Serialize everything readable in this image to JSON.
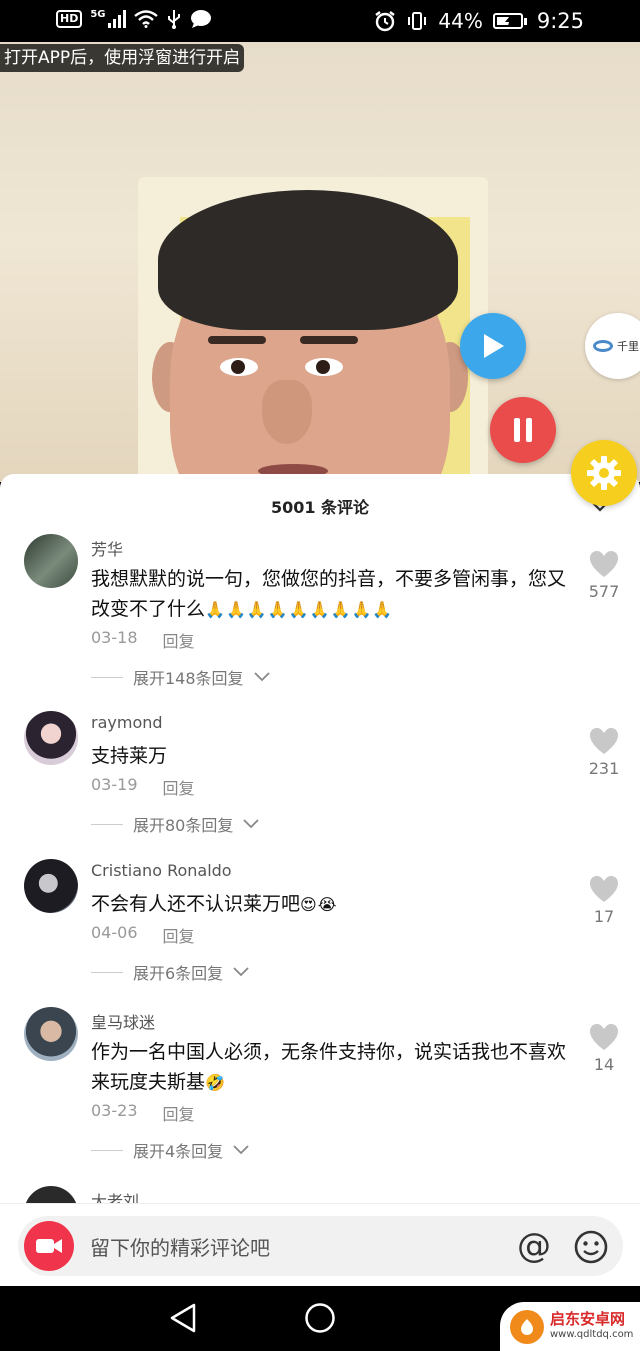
{
  "status_bar": {
    "hd": "HD",
    "network": "5G",
    "battery_percent": "44%",
    "battery_level": 0.44,
    "time": "9:25",
    "icons": [
      "signal-icon",
      "wifi-icon",
      "usb-icon",
      "chat-icon",
      "alarm-icon",
      "vibrate-icon",
      "battery-icon"
    ]
  },
  "video": {
    "banner": "打开APP后，使用浮窗进行开启",
    "side_logo_text": "千里"
  },
  "comments_panel": {
    "title": "5001 条评论",
    "reply_label": "回复",
    "comments": [
      {
        "user": "芳华",
        "text": "我想默默的说一句，您做您的抖音，不要多管闲事，您又改变不了什么",
        "emoji": "🙏🙏🙏🙏🙏🙏🙏🙏🙏",
        "date": "03-18",
        "expand": "展开148条回复",
        "likes": "577"
      },
      {
        "user": "raymond",
        "text": "支持莱万",
        "emoji": "",
        "date": "03-19",
        "expand": "展开80条回复",
        "likes": "231"
      },
      {
        "user": "Cristiano Ronaldo",
        "text": "不会有人还不认识莱万吧",
        "emoji": "😍😭",
        "date": "04-06",
        "expand": "展开6条回复",
        "likes": "17"
      },
      {
        "user": "皇马球迷",
        "text": "作为一名中国人必须，无条件支持你，说实话我也不喜欢来玩度夫斯基",
        "emoji": "🤣",
        "date": "03-23",
        "expand": "展开4条回复",
        "likes": "14"
      },
      {
        "user": "大老刘"
      }
    ]
  },
  "input_bar": {
    "placeholder": "留下你的精彩评论吧",
    "at_symbol": "@"
  },
  "watermark": {
    "title": "启东安卓网",
    "url": "www.qdltdq.com"
  },
  "colors": {
    "play": "#3da7ec",
    "pause": "#ea4b4b",
    "settings": "#f6ce1d",
    "camera": "#f0344c"
  }
}
